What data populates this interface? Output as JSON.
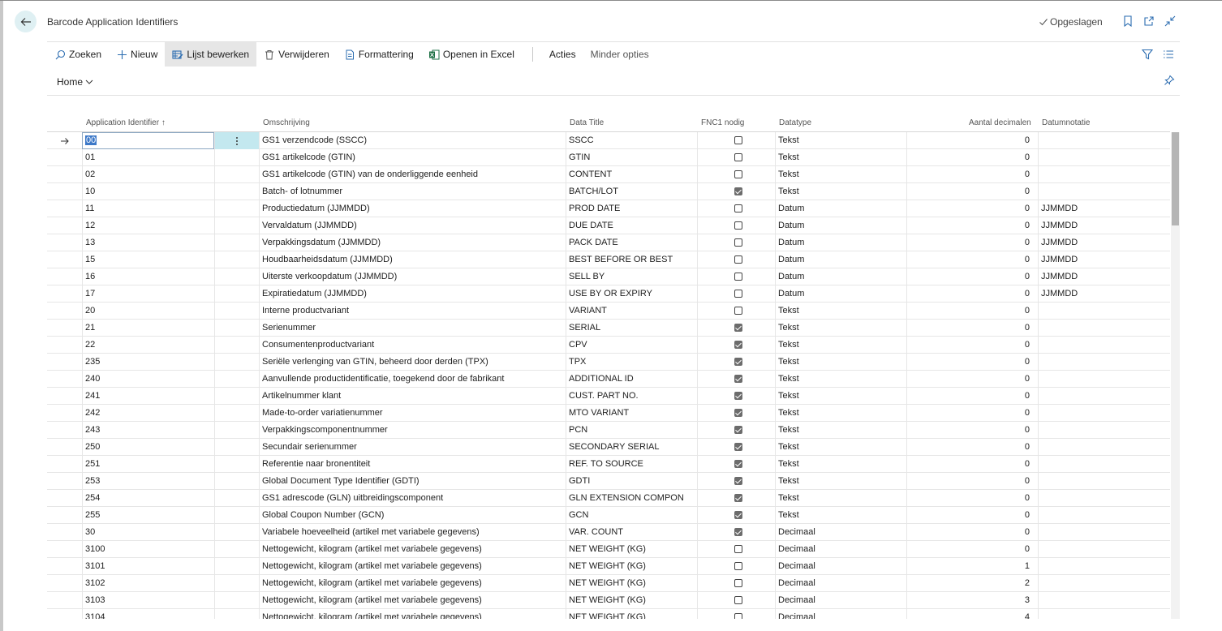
{
  "header": {
    "title": "Barcode Application Identifiers",
    "saved_label": "Opgeslagen"
  },
  "actions": {
    "search": "Zoeken",
    "new": "Nieuw",
    "edit_list": "Lijst bewerken",
    "delete": "Verwijderen",
    "formatting": "Formattering",
    "open_excel": "Openen in Excel",
    "actions": "Acties",
    "fewer_options": "Minder opties"
  },
  "tabs": {
    "home": "Home"
  },
  "columns": {
    "ai": "Application Identifier",
    "ai_sort": "↑",
    "description": "Omschrijving",
    "data_title": "Data Title",
    "fnc1": "FNC1 nodig",
    "datatype": "Datatype",
    "decimals": "Aantal decimalen",
    "date_format": "Datumnotatie"
  },
  "rows": [
    {
      "ai": "00",
      "desc": "GS1 verzendcode (SSCC)",
      "title": "SSCC",
      "fnc1": false,
      "type": "Tekst",
      "dec": "0",
      "fmt": ""
    },
    {
      "ai": "01",
      "desc": "GS1 artikelcode (GTIN)",
      "title": "GTIN",
      "fnc1": false,
      "type": "Tekst",
      "dec": "0",
      "fmt": ""
    },
    {
      "ai": "02",
      "desc": "GS1 artikelcode (GTIN) van de onderliggende eenheid",
      "title": "CONTENT",
      "fnc1": false,
      "type": "Tekst",
      "dec": "0",
      "fmt": ""
    },
    {
      "ai": "10",
      "desc": "Batch- of lotnummer",
      "title": "BATCH/LOT",
      "fnc1": true,
      "type": "Tekst",
      "dec": "0",
      "fmt": ""
    },
    {
      "ai": "11",
      "desc": "Productiedatum (JJMMDD)",
      "title": "PROD DATE",
      "fnc1": false,
      "type": "Datum",
      "dec": "0",
      "fmt": "JJMMDD"
    },
    {
      "ai": "12",
      "desc": "Vervaldatum (JJMMDD)",
      "title": "DUE DATE",
      "fnc1": false,
      "type": "Datum",
      "dec": "0",
      "fmt": "JJMMDD"
    },
    {
      "ai": "13",
      "desc": "Verpakkingsdatum (JJMMDD)",
      "title": "PACK DATE",
      "fnc1": false,
      "type": "Datum",
      "dec": "0",
      "fmt": "JJMMDD"
    },
    {
      "ai": "15",
      "desc": "Houdbaarheidsdatum (JJMMDD)",
      "title": "BEST BEFORE OR BEST",
      "fnc1": false,
      "type": "Datum",
      "dec": "0",
      "fmt": "JJMMDD"
    },
    {
      "ai": "16",
      "desc": "Uiterste verkoopdatum (JJMMDD)",
      "title": "SELL BY",
      "fnc1": false,
      "type": "Datum",
      "dec": "0",
      "fmt": "JJMMDD"
    },
    {
      "ai": "17",
      "desc": "Expiratiedatum (JJMMDD)",
      "title": "USE BY OR EXPIRY",
      "fnc1": false,
      "type": "Datum",
      "dec": "0",
      "fmt": "JJMMDD"
    },
    {
      "ai": "20",
      "desc": "Interne productvariant",
      "title": "VARIANT",
      "fnc1": false,
      "type": "Tekst",
      "dec": "0",
      "fmt": ""
    },
    {
      "ai": "21",
      "desc": "Serienummer",
      "title": "SERIAL",
      "fnc1": true,
      "type": "Tekst",
      "dec": "0",
      "fmt": ""
    },
    {
      "ai": "22",
      "desc": "Consumentenproductvariant",
      "title": "CPV",
      "fnc1": true,
      "type": "Tekst",
      "dec": "0",
      "fmt": ""
    },
    {
      "ai": "235",
      "desc": "Seriële verlenging van GTIN, beheerd door derden (TPX)",
      "title": "TPX",
      "fnc1": true,
      "type": "Tekst",
      "dec": "0",
      "fmt": ""
    },
    {
      "ai": "240",
      "desc": "Aanvullende productidentificatie, toegekend door de fabrikant",
      "title": "ADDITIONAL ID",
      "fnc1": true,
      "type": "Tekst",
      "dec": "0",
      "fmt": ""
    },
    {
      "ai": "241",
      "desc": "Artikelnummer klant",
      "title": "CUST. PART NO.",
      "fnc1": true,
      "type": "Tekst",
      "dec": "0",
      "fmt": ""
    },
    {
      "ai": "242",
      "desc": "Made-to-order variatienummer",
      "title": "MTO VARIANT",
      "fnc1": true,
      "type": "Tekst",
      "dec": "0",
      "fmt": ""
    },
    {
      "ai": "243",
      "desc": "Verpakkingscomponentnummer",
      "title": "PCN",
      "fnc1": true,
      "type": "Tekst",
      "dec": "0",
      "fmt": ""
    },
    {
      "ai": "250",
      "desc": "Secundair serienummer",
      "title": "SECONDARY SERIAL",
      "fnc1": true,
      "type": "Tekst",
      "dec": "0",
      "fmt": ""
    },
    {
      "ai": "251",
      "desc": "Referentie naar bronentiteit",
      "title": "REF. TO SOURCE",
      "fnc1": true,
      "type": "Tekst",
      "dec": "0",
      "fmt": ""
    },
    {
      "ai": "253",
      "desc": "Global Document Type Identifier (GDTI)",
      "title": "GDTI",
      "fnc1": true,
      "type": "Tekst",
      "dec": "0",
      "fmt": ""
    },
    {
      "ai": "254",
      "desc": "GS1 adrescode (GLN) uitbreidingscomponent",
      "title": "GLN EXTENSION COMPON",
      "fnc1": true,
      "type": "Tekst",
      "dec": "0",
      "fmt": ""
    },
    {
      "ai": "255",
      "desc": "Global Coupon Number (GCN)",
      "title": "GCN",
      "fnc1": true,
      "type": "Tekst",
      "dec": "0",
      "fmt": ""
    },
    {
      "ai": "30",
      "desc": "Variabele hoeveelheid (artikel met variabele gegevens)",
      "title": "VAR. COUNT",
      "fnc1": true,
      "type": "Decimaal",
      "dec": "0",
      "fmt": ""
    },
    {
      "ai": "3100",
      "desc": "Nettogewicht, kilogram (artikel met variabele gegevens)",
      "title": "NET WEIGHT (KG)",
      "fnc1": false,
      "type": "Decimaal",
      "dec": "0",
      "fmt": ""
    },
    {
      "ai": "3101",
      "desc": "Nettogewicht, kilogram (artikel met variabele gegevens)",
      "title": "NET WEIGHT (KG)",
      "fnc1": false,
      "type": "Decimaal",
      "dec": "1",
      "fmt": ""
    },
    {
      "ai": "3102",
      "desc": "Nettogewicht, kilogram (artikel met variabele gegevens)",
      "title": "NET WEIGHT (KG)",
      "fnc1": false,
      "type": "Decimaal",
      "dec": "2",
      "fmt": ""
    },
    {
      "ai": "3103",
      "desc": "Nettogewicht, kilogram (artikel met variabele gegevens)",
      "title": "NET WEIGHT (KG)",
      "fnc1": false,
      "type": "Decimaal",
      "dec": "3",
      "fmt": ""
    },
    {
      "ai": "3104",
      "desc": "Nettogewicht, kilogram (artikel met variabele gegevens)",
      "title": "NET WEIGHT (KG)",
      "fnc1": false,
      "type": "Decimaal",
      "dec": "4",
      "fmt": ""
    }
  ],
  "colors": {
    "accent": "#3d79c8",
    "selected_cell": "#c3e8ef"
  }
}
